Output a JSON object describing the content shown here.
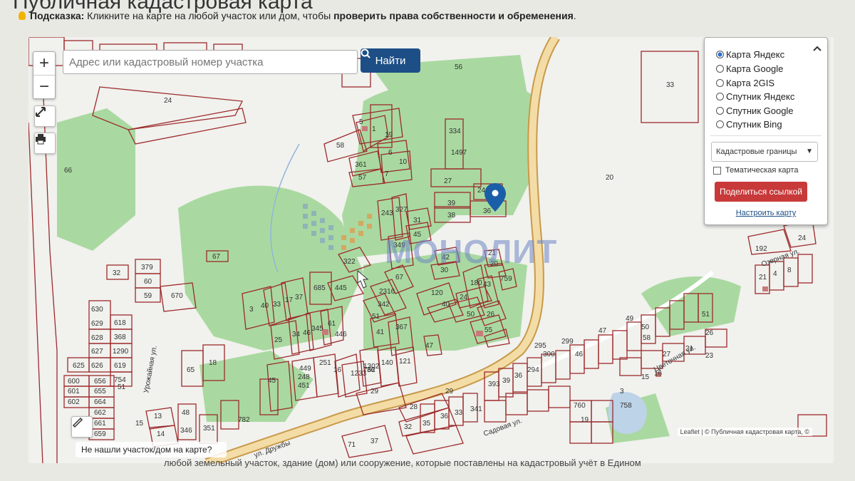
{
  "page": {
    "title": "Публичная кадастровая карта",
    "hint_label": "Подсказка:",
    "hint_text": " Кликните на карте на любой участок или дом, чтобы ",
    "hint_bold": "проверить права собственности и обременения",
    "hint_end": ".",
    "footer_text": "любой земельный участок, здание (дом) или сооружение, которые поставлены на кадастровый учёт в Едином"
  },
  "map": {
    "zoom_in": "+",
    "zoom_out": "−",
    "search": {
      "placeholder": "Адрес или кадастровый номер участка",
      "value": ""
    },
    "find_button": "Найти",
    "not_found": "Не нашли участок/дом на карте?",
    "attribution": "Leaflet | © Публичная кадастровая карта, ©",
    "watermark": "МОНОЛИТ",
    "streets": [
      "ул. Дружбы",
      "Урожайная ул.",
      "Озерная ул.",
      "Цветочная ул.",
      "Садовая ул."
    ],
    "parcel_labels": [
      "24",
      "66",
      "56",
      "33",
      "20",
      "5",
      "1",
      "19",
      "58",
      "6",
      "10",
      "361",
      "57",
      "7",
      "334",
      "1497",
      "27",
      "24",
      "39",
      "38",
      "36",
      "243",
      "327",
      "31",
      "45",
      "349",
      "42",
      "30",
      "21",
      "20",
      "759",
      "180",
      "43",
      "67",
      "2316",
      "342",
      "51",
      "120",
      "40",
      "50",
      "26",
      "24",
      "55",
      "322",
      "445",
      "685",
      "3",
      "40",
      "33",
      "17",
      "37",
      "25",
      "34",
      "46",
      "345",
      "61",
      "41",
      "367",
      "47",
      "1302",
      "140",
      "121",
      "762",
      "251",
      "16",
      "1233",
      "45",
      "449",
      "248",
      "451",
      "379",
      "60",
      "59",
      "670",
      "32",
      "67",
      "618",
      "368",
      "1290",
      "619",
      "754",
      "51",
      "656",
      "655",
      "664",
      "662",
      "661",
      "659",
      "600",
      "601",
      "602",
      "625",
      "626",
      "630",
      "629",
      "628",
      "627",
      "13",
      "14",
      "15",
      "48",
      "346",
      "351",
      "18",
      "65",
      "29",
      "28",
      "32",
      "35",
      "36",
      "33",
      "393",
      "39",
      "36",
      "294",
      "295",
      "300",
      "299",
      "46",
      "47",
      "49",
      "50",
      "58",
      "51",
      "26",
      "27",
      "21",
      "23",
      "24",
      "192",
      "21",
      "4",
      "8",
      "3",
      "15",
      "16",
      "19",
      "760",
      "758",
      "341",
      "36",
      "782",
      "446",
      "29",
      "71",
      "37",
      "38"
    ],
    "colors": {
      "parcel_stroke": "#9b2b2b",
      "green": "#a9d9a0",
      "road_fill": "#f4dca6",
      "road_stroke": "#c79a4a",
      "accent": "#1d4f86",
      "share": "#c8393a",
      "marker": "#1b5ea8"
    }
  },
  "layers_panel": {
    "options": [
      {
        "label": "Карта Яндекс",
        "selected": true
      },
      {
        "label": "Карта Google",
        "selected": false
      },
      {
        "label": "Карта 2GIS",
        "selected": false
      },
      {
        "label": "Спутник Яндекс",
        "selected": false
      },
      {
        "label": "Спутник Google",
        "selected": false
      },
      {
        "label": "Спутник Bing",
        "selected": false
      }
    ],
    "overlay_select": "Кадастровые границы",
    "thematic_label": "Тематическая карта",
    "share_button": "Поделиться ссылкой",
    "configure_link": "Настроить карту"
  }
}
